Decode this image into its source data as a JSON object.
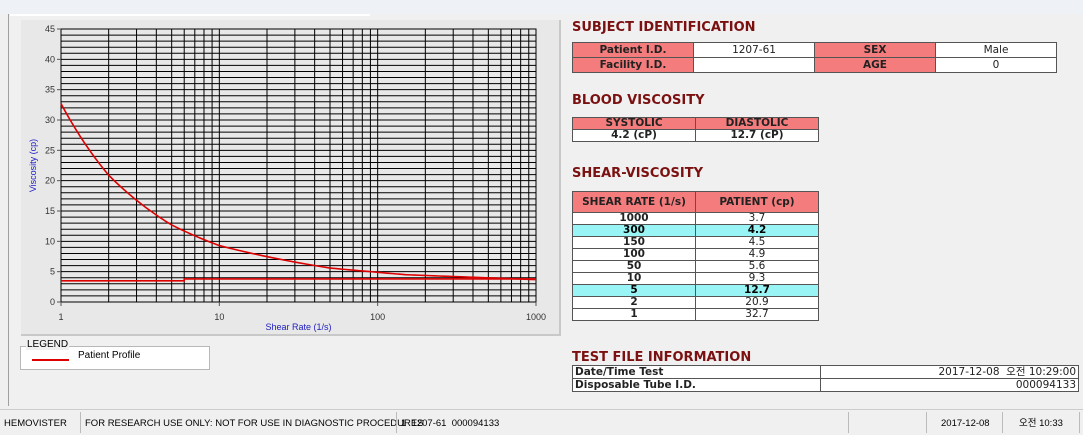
{
  "chart_data": {
    "type": "line",
    "xlabel": "Shear Rate (1/s)",
    "ylabel": "Viscosity (cp)",
    "x_scale": "log",
    "xlim": [
      1,
      1000
    ],
    "ylim": [
      0,
      45
    ],
    "x_ticks": [
      "1",
      "10",
      "100",
      "1000"
    ],
    "y_ticks": [
      "0",
      "5",
      "10",
      "15",
      "20",
      "25",
      "30",
      "35",
      "40",
      "45"
    ],
    "grid": true,
    "legend_position": "bottom-left",
    "series": [
      {
        "name": "Patient Profile",
        "color": "#dd0000",
        "x": [
          1,
          2,
          5,
          10,
          50,
          100,
          150,
          300,
          1000
        ],
        "y": [
          32.7,
          20.9,
          12.7,
          9.3,
          5.6,
          4.9,
          4.5,
          4.2,
          3.7
        ]
      },
      {
        "color": "#dd0000",
        "x": [
          1,
          6,
          6,
          1000
        ],
        "y": [
          3.5,
          3.5,
          3.8,
          3.8
        ]
      }
    ]
  },
  "legend": {
    "title": "LEGEND",
    "item": "Patient Profile"
  },
  "subject": {
    "title": "SUBJECT IDENTIFICATION",
    "patient_id_label": "Patient I.D.",
    "patient_id": "1207-61",
    "sex_label": "SEX",
    "sex": "Male",
    "facility_id_label": "Facility I.D.",
    "facility_id": "",
    "age_label": "AGE",
    "age": "0"
  },
  "blood": {
    "title": "BLOOD VISCOSITY",
    "systolic_label": "SYSTOLIC",
    "diastolic_label": "DIASTOLIC",
    "systolic": "4.2 (cP)",
    "diastolic": "12.7 (cP)"
  },
  "shear": {
    "title": "SHEAR-VISCOSITY",
    "headers": [
      "SHEAR RATE (1/s)",
      "PATIENT (cp)"
    ],
    "rows": [
      {
        "rate": "1000",
        "value": "3.7",
        "highlight": false
      },
      {
        "rate": "300",
        "value": "4.2",
        "highlight": true
      },
      {
        "rate": "150",
        "value": "4.5",
        "highlight": false
      },
      {
        "rate": "100",
        "value": "4.9",
        "highlight": false
      },
      {
        "rate": "50",
        "value": "5.6",
        "highlight": false
      },
      {
        "rate": "10",
        "value": "9.3",
        "highlight": false
      },
      {
        "rate": "5",
        "value": "12.7",
        "highlight": true
      },
      {
        "rate": "2",
        "value": "20.9",
        "highlight": false
      },
      {
        "rate": "1",
        "value": "32.7",
        "highlight": false
      }
    ]
  },
  "testfile": {
    "title": "TEST FILE INFORMATION",
    "datetime_label": "Date/Time Test",
    "datetime": "2017-12-08  오전 10:29:00",
    "tube_label": "Disposable Tube I.D.",
    "tube": "000094133"
  },
  "status": {
    "app": "HEMOVISTER",
    "notice": "FOR RESEARCH USE ONLY: NOT FOR USE IN DIAGNOSTIC PROCEDURES",
    "record": "1  1207-61  000094133",
    "empty": "",
    "date": "2017-12-08",
    "time": "오전 10:33"
  },
  "colors": {
    "header": "#f47c7c",
    "highlight": "#99f5f5",
    "title": "#7a1010",
    "curve": "#dd0000"
  }
}
